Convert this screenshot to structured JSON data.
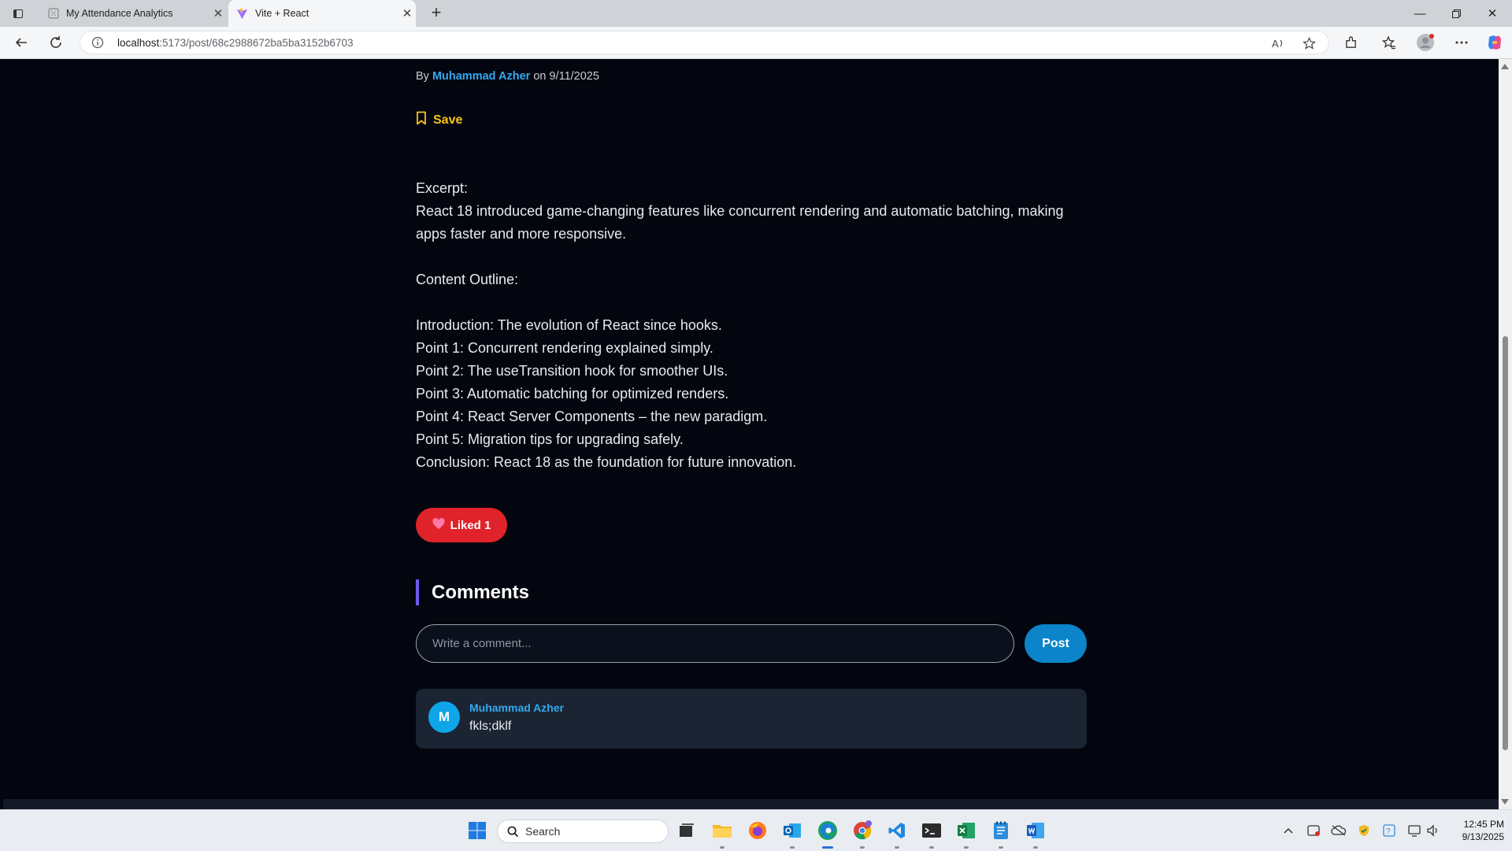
{
  "browser": {
    "tabs": [
      {
        "title": "My Attendance Analytics",
        "active": false
      },
      {
        "title": "Vite + React",
        "active": true
      }
    ],
    "url_host": "localhost",
    "url_path": ":5173/post/68c2988672ba5ba3152b6703"
  },
  "post": {
    "by_label": "By",
    "author": "Muhammad Azher",
    "on_label": "on",
    "date": "9/11/2025",
    "save_label": "Save",
    "excerpt_heading": "Excerpt:",
    "excerpt": "React 18 introduced game-changing features like concurrent rendering and automatic batching, making apps faster and more responsive.",
    "outline_heading": "Content Outline:",
    "outline": [
      "Introduction: The evolution of React since hooks.",
      "Point 1: Concurrent rendering explained simply.",
      "Point 2: The useTransition hook for smoother UIs.",
      "Point 3: Automatic batching for optimized renders.",
      "Point 4: React Server Components – the new paradigm.",
      "Point 5: Migration tips for upgrading safely.",
      "Conclusion: React 18 as the foundation for future innovation."
    ],
    "like_label": "Liked 1"
  },
  "comments": {
    "title": "Comments",
    "input_placeholder": "Write a comment...",
    "post_label": "Post",
    "items": [
      {
        "initial": "M",
        "author": "Muhammad Azher",
        "text": "fkls;dklf"
      }
    ]
  },
  "taskbar": {
    "search_placeholder": "Search",
    "time": "12:45 PM",
    "date": "9/13/2025"
  },
  "colors": {
    "page_bg": "#03060f",
    "author_link": "#35a8f0",
    "save": "#f5c518",
    "like": "#e0222a",
    "post_button": "#0b84c9",
    "comment_card": "#1b2432",
    "accent_bar": "#6a5cf0"
  }
}
